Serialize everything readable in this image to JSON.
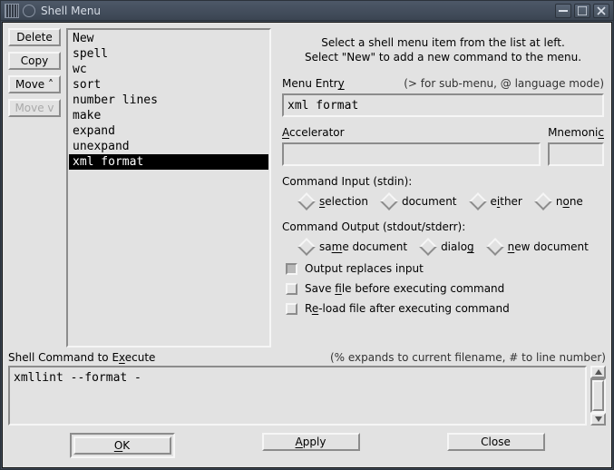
{
  "window": {
    "title": "Shell Menu"
  },
  "leftButtons": {
    "delete": "Delete",
    "copy": "Copy",
    "moveUp": "Move ˄",
    "moveDown": "Move v"
  },
  "list": {
    "items": [
      "New",
      "spell",
      "wc",
      "sort",
      "number lines",
      "make",
      "expand",
      "unexpand",
      "xml format"
    ],
    "selectedIndex": 8
  },
  "intro": {
    "line1": "Select a shell menu item from the list at left.",
    "line2": "Select \"New\" to add a new command to the menu."
  },
  "menuEntry": {
    "label_pre": "Menu Entr",
    "label_u": "y",
    "hint": "(> for sub-menu, @ language mode)",
    "value": "xml format"
  },
  "accelerator": {
    "label_pre": "",
    "label_u": "A",
    "label_post": "ccelerator",
    "value": ""
  },
  "mnemonic": {
    "label_pre": "Mnemoni",
    "label_u": "c",
    "value": ""
  },
  "cmdInput": {
    "label": "Command Input (stdin):",
    "options": [
      {
        "pre": "",
        "u": "s",
        "post": "election"
      },
      {
        "pre": "document",
        "u": "",
        "post": ""
      },
      {
        "pre": "e",
        "u": "i",
        "post": "ther"
      },
      {
        "pre": "n",
        "u": "o",
        "post": "ne"
      }
    ],
    "selectedIndex": -1
  },
  "cmdOutput": {
    "label": "Command Output (stdout/stderr):",
    "options": [
      {
        "pre": "sa",
        "u": "m",
        "post": "e document"
      },
      {
        "pre": "dialo",
        "u": "g",
        "post": ""
      },
      {
        "pre": "",
        "u": "n",
        "post": "ew document"
      }
    ],
    "selectedIndex": -1
  },
  "checks": {
    "outputReplaces": {
      "pre": "Output replaces input",
      "u": "",
      "post": "",
      "checked": true
    },
    "saveBefore": {
      "pre": "Save ",
      "u": "f",
      "post": "ile before executing command",
      "checked": false
    },
    "reload": {
      "pre": "R",
      "u": "e",
      "post": "-load file after executing command",
      "checked": false
    }
  },
  "command": {
    "label_pre": "Shell Command to E",
    "label_u": "x",
    "label_post": "ecute",
    "hint": "(% expands to current filename, # to line number)",
    "value": "xmllint --format -"
  },
  "buttons": {
    "ok": {
      "pre": "",
      "u": "O",
      "post": "K"
    },
    "apply": {
      "pre": "",
      "u": "A",
      "post": "pply"
    },
    "close": {
      "pre": "Close",
      "u": "",
      "post": ""
    }
  }
}
